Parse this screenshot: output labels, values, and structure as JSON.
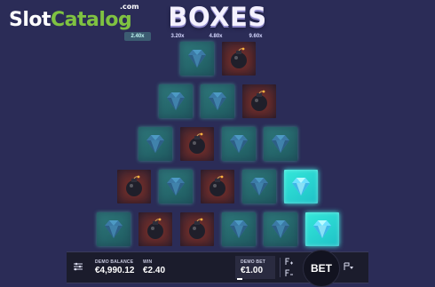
{
  "logo": {
    "part1": "Slot",
    "part2": "Catalog",
    "suffix": ".com"
  },
  "game_title": "BOXES",
  "multipliers": [
    {
      "label": "2.40x",
      "active": true
    },
    {
      "label": "3.20x",
      "active": false
    },
    {
      "label": "4.80x",
      "active": false
    },
    {
      "label": "9.60x",
      "active": false
    }
  ],
  "board": {
    "rows": [
      [
        "gem",
        "bomb"
      ],
      [
        "gem",
        "gem",
        "bomb"
      ],
      [
        "gem",
        "bomb",
        "gem",
        "gem"
      ],
      [
        "bomb",
        "gem",
        "bomb",
        "gem",
        "gem-lit"
      ],
      [
        "gem",
        "bomb",
        "bomb",
        "gem",
        "gem",
        "gem-lit"
      ]
    ]
  },
  "hud": {
    "settings_icon": "sliders-icon",
    "balance_label": "DEMO BALANCE",
    "balance_value": "€4,990.12",
    "win_label": "WIN",
    "win_value": "€2.40",
    "bet_label": "DEMO BET",
    "bet_value": "€1.00",
    "bet_button_label": "BET",
    "autoplay_icon": "autoplay-icon"
  },
  "colors": {
    "background": "#2b2c57",
    "gem_box": "#2f7a7c",
    "bomb_box": "#5a2a2d",
    "lit_box": "#34e8da",
    "logo_green": "#7fc241"
  }
}
